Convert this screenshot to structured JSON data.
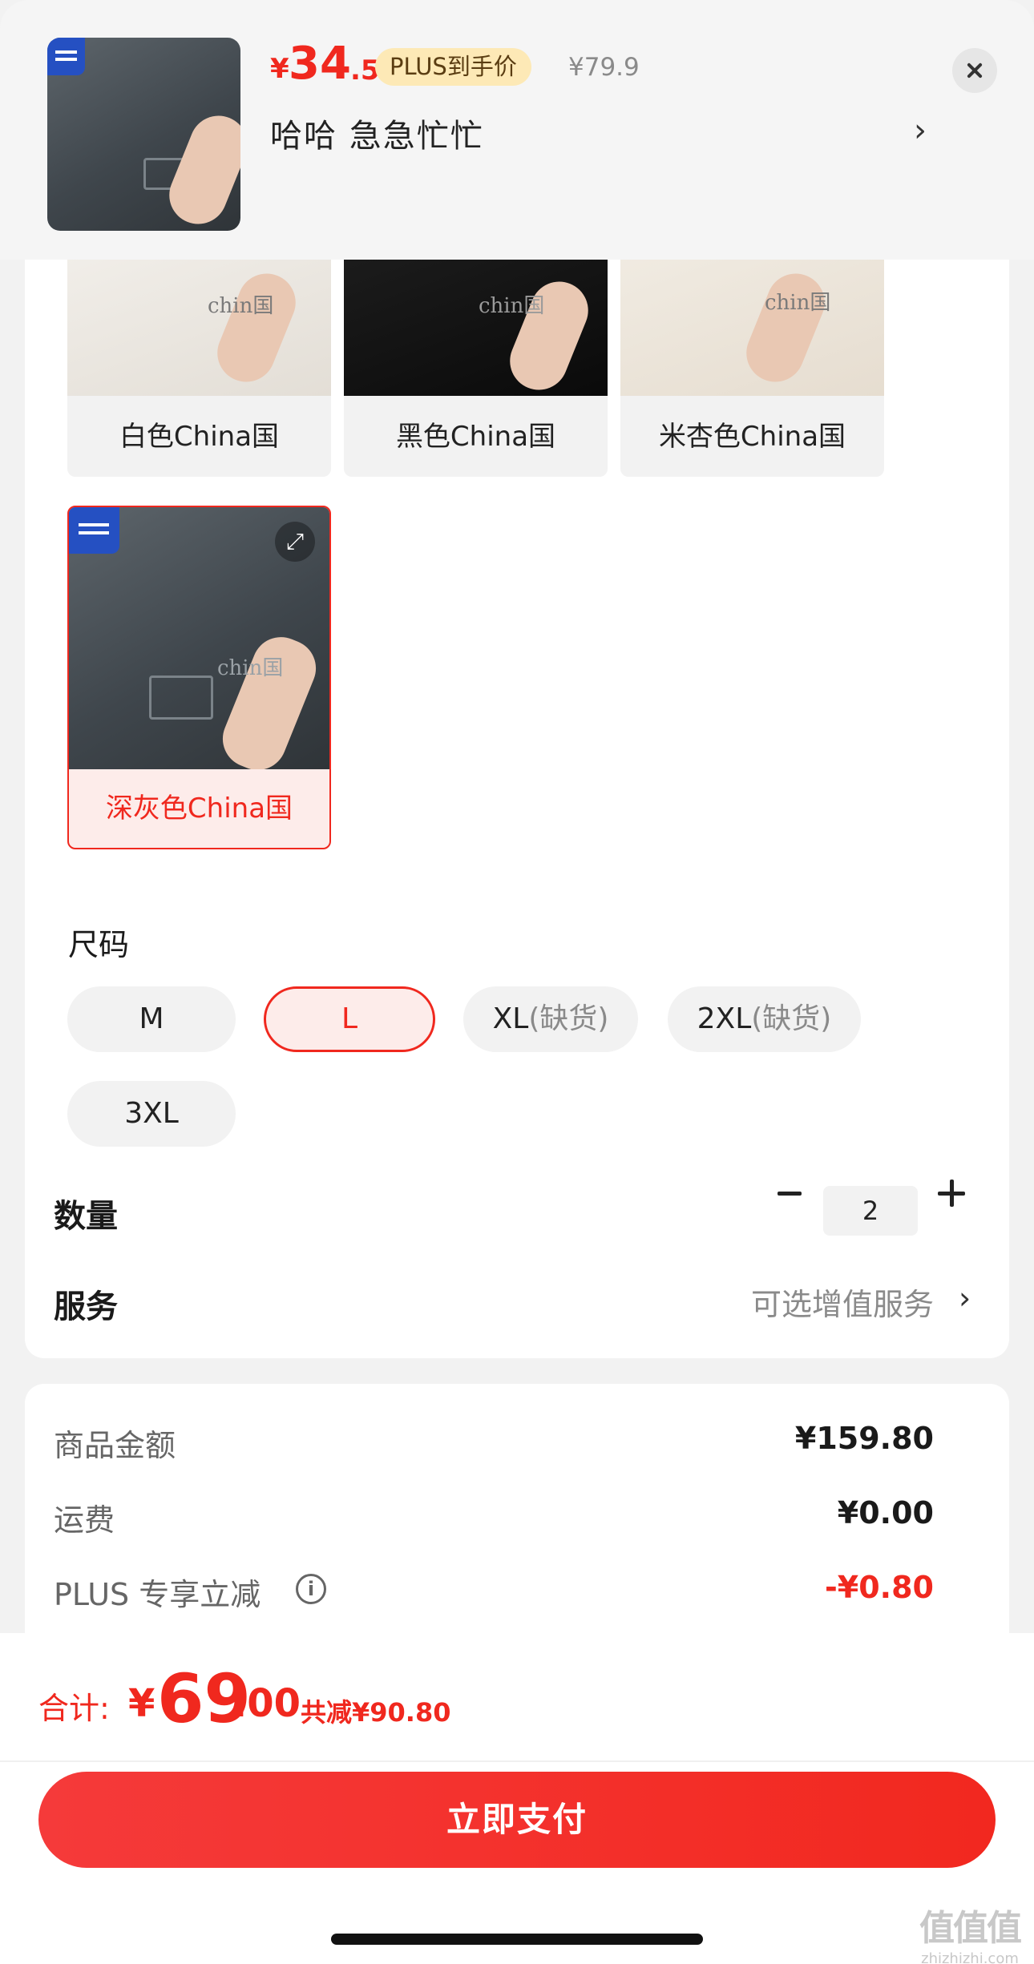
{
  "header": {
    "currency": "¥",
    "price_int": "34",
    "price_dec": ".5",
    "plus_badge": "PLUS到手价",
    "original_price": "¥79.9",
    "selected_sku": "哈哈  急急忙忙",
    "chevron": "›",
    "close_icon": "close-icon"
  },
  "colors": [
    {
      "label": "白色China国",
      "selected": false
    },
    {
      "label": "黑色China国",
      "selected": false
    },
    {
      "label": "米杏色China国",
      "selected": false
    },
    {
      "label": "深灰色China国",
      "selected": true
    }
  ],
  "color_image_mark": "chin国",
  "size": {
    "title": "尺码",
    "options": [
      {
        "label": "M",
        "note": "",
        "selected": false
      },
      {
        "label": "L",
        "note": "",
        "selected": true
      },
      {
        "label": "XL",
        "note": "(缺货)",
        "selected": false
      },
      {
        "label": "2XL",
        "note": "(缺货)",
        "selected": false
      },
      {
        "label": "3XL",
        "note": "",
        "selected": false
      }
    ]
  },
  "quantity": {
    "label": "数量",
    "value": "2"
  },
  "service": {
    "label": "服务",
    "value": "可选增值服务",
    "chevron": "›"
  },
  "summary": {
    "goods_label": "商品金额",
    "goods_value": "¥159.80",
    "shipping_label": "运费",
    "shipping_value": "¥0.00",
    "plus_label": "PLUS 专享立减",
    "plus_value": "-¥0.80",
    "info_icon": "i"
  },
  "total": {
    "label": "合计:",
    "currency": "¥",
    "int": "69",
    "dec": ".00",
    "saved": "共减¥90.80"
  },
  "pay_button": "立即支付",
  "watermark": {
    "big": "值值值",
    "small": "zhizhizhi.com"
  },
  "colors_theme": {
    "accent": "#f0281e",
    "plus_badge_bg": "#fde9b6"
  }
}
